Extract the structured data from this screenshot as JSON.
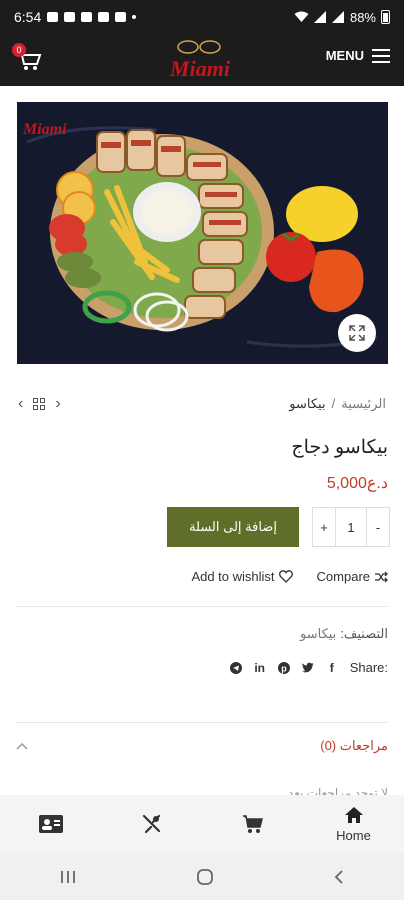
{
  "status_bar": {
    "time": "6:54",
    "battery": "88%"
  },
  "header": {
    "cart_count": "0",
    "logo_text": "Miami",
    "menu_label": "MENU"
  },
  "image": {
    "logo_text": "Miami"
  },
  "breadcrumb": {
    "home": "الرئيسية",
    "separator": "/",
    "current": "بيكاسو"
  },
  "product": {
    "title": "بيكاسو دجاج",
    "price": "5,000د.ع",
    "quantity": "1",
    "qty_minus": "-",
    "qty_plus": "+",
    "add_to_cart": "إضافة إلى السلة"
  },
  "actions": {
    "compare": "Compare",
    "wishlist": "Add to wishlist"
  },
  "meta": {
    "category_label": "التصنيف:",
    "category_value": "بيكاسو",
    "share_label": "Share:"
  },
  "reviews": {
    "tab_label": "مراجعات (0)",
    "empty_text": "لا توجد مراجعات بعد."
  },
  "bottom_nav": {
    "home_label": "Home"
  },
  "colors": {
    "accent": "#5f6f2a",
    "price": "#c53c25",
    "header": "#1c1c1c",
    "badge": "#d3212e"
  }
}
